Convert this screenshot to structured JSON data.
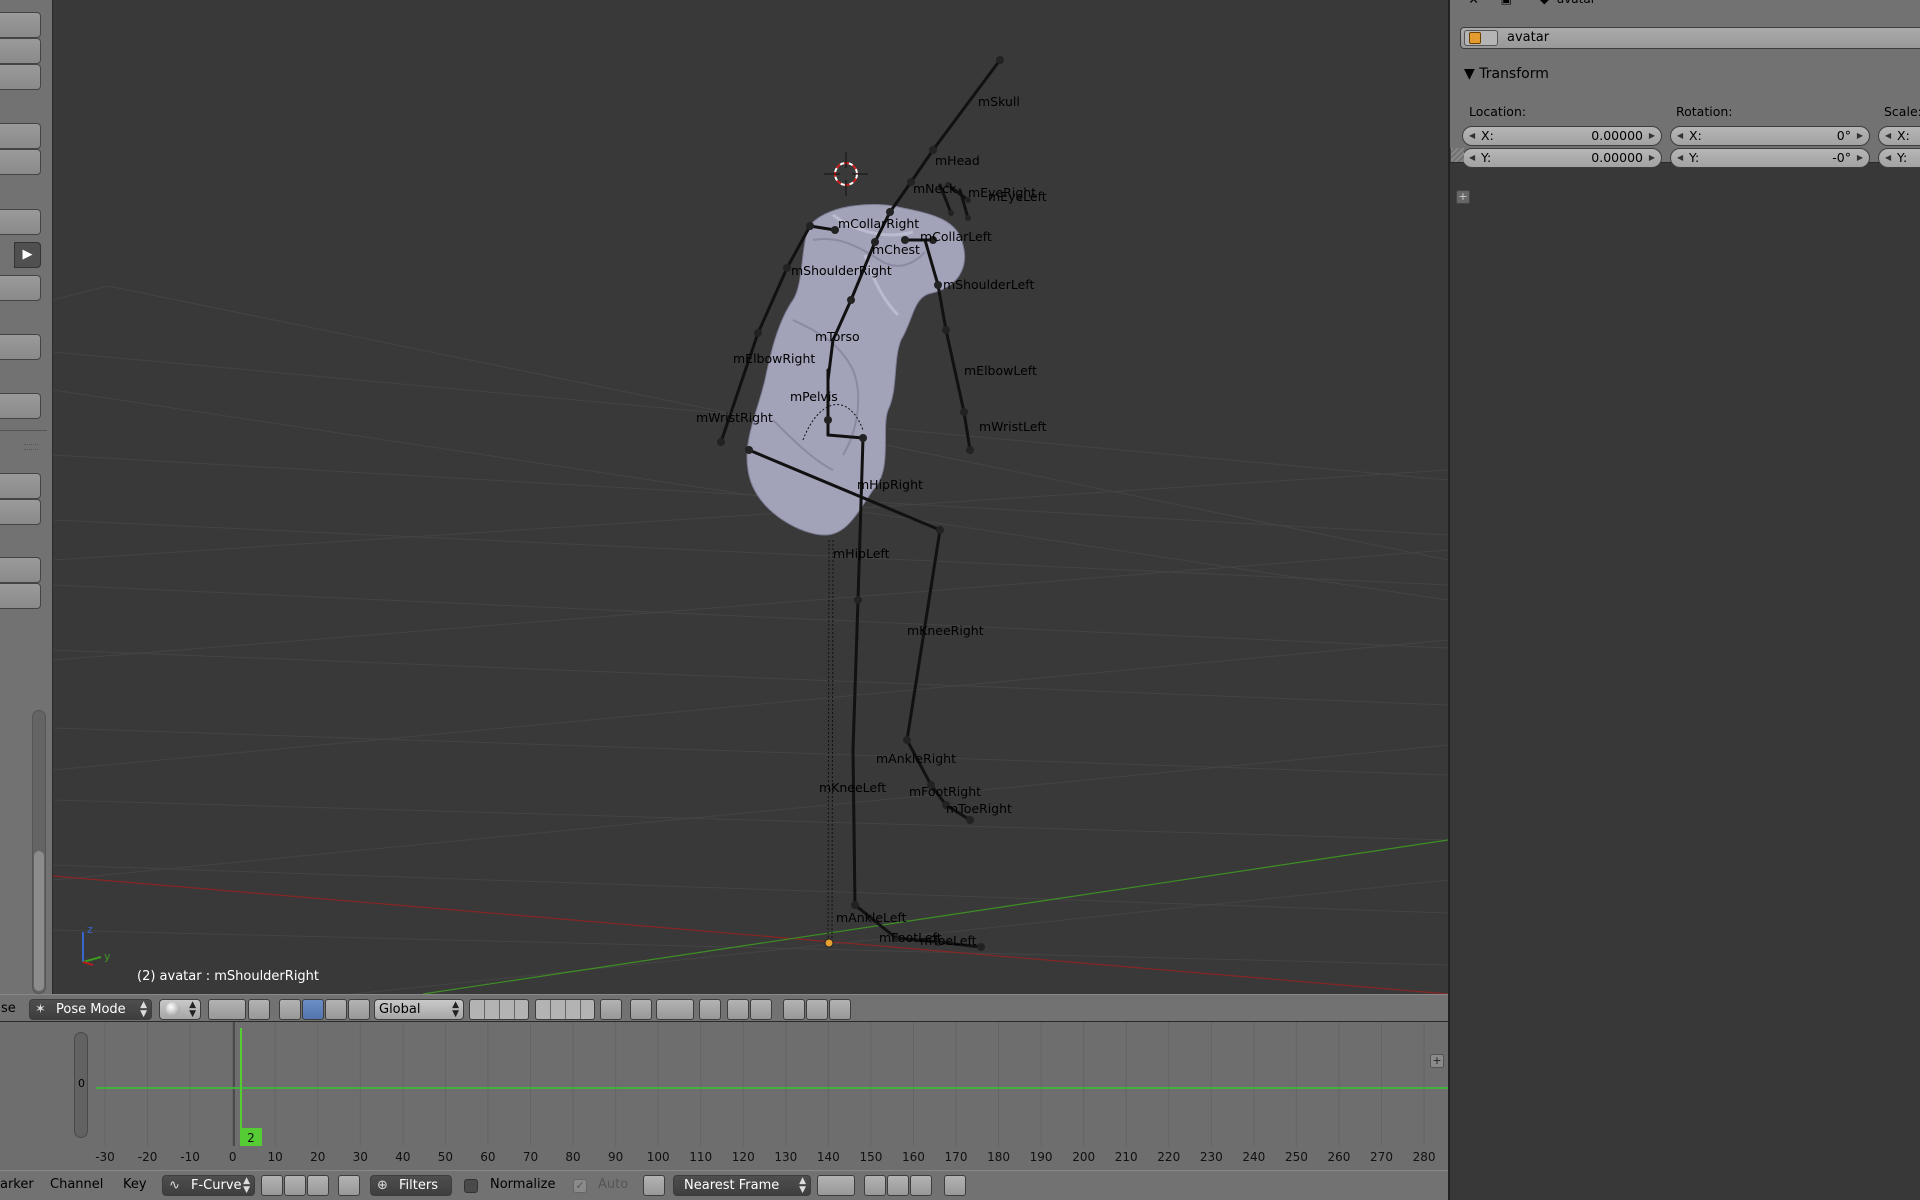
{
  "viewport": {
    "status": "(2) avatar : mShoulderRight",
    "axis_labels": {
      "z": "z",
      "y": "y"
    },
    "bones": [
      {
        "label": "mSkull"
      },
      {
        "label": "mHead"
      },
      {
        "label": "mNeck"
      },
      {
        "label": "mEyeRight"
      },
      {
        "label": "mEyeLeft"
      },
      {
        "label": "mCollarRight"
      },
      {
        "label": "mCollarLeft"
      },
      {
        "label": "mChest"
      },
      {
        "label": "mShoulderRight"
      },
      {
        "label": "mShoulderLeft"
      },
      {
        "label": "mTorso"
      },
      {
        "label": "mElbowRight"
      },
      {
        "label": "mElbowLeft"
      },
      {
        "label": "mPelvis"
      },
      {
        "label": "mWristRight"
      },
      {
        "label": "mWristLeft"
      },
      {
        "label": "mHipRight"
      },
      {
        "label": "mHipLeft"
      },
      {
        "label": "mKneeRight"
      },
      {
        "label": "mAnkleRight"
      },
      {
        "label": "mFootRight"
      },
      {
        "label": "mKneeLeft"
      },
      {
        "label": "mToeRight"
      },
      {
        "label": "mAnkleLeft"
      },
      {
        "label": "mFootLeft"
      },
      {
        "label": "mToeLeft"
      }
    ]
  },
  "header3d": {
    "menu_fragment": "se",
    "mode": "Pose Mode",
    "orientation": "Global"
  },
  "timeline": {
    "y_label": "0",
    "current_frame": "2",
    "ticks": [
      "-30",
      "-20",
      "-10",
      "0",
      "10",
      "20",
      "30",
      "40",
      "50",
      "60",
      "70",
      "80",
      "90",
      "100",
      "110",
      "120",
      "130",
      "140",
      "150",
      "160",
      "170",
      "180",
      "190",
      "200",
      "210",
      "220",
      "230",
      "240",
      "250",
      "260",
      "270",
      "280"
    ]
  },
  "header_graph": {
    "menu_marker": "arker",
    "menu_channel": "Channel",
    "menu_key": "Key",
    "editor_mode": "F-Curve",
    "filters": "Filters",
    "normalize": "Normalize",
    "auto": "Auto",
    "snap": "Nearest Frame"
  },
  "properties": {
    "tab_fragment": "avatar",
    "object_name": "avatar",
    "transform_header": "Transform",
    "location_label": "Location:",
    "rotation_label": "Rotation:",
    "scale_label": "Scale:",
    "loc_x_label": "X:",
    "loc_x_value": "0.00000",
    "loc_y_label": "Y:",
    "loc_y_value": "0.00000",
    "rot_x_label": "X:",
    "rot_x_value": "0°",
    "rot_y_label": "Y:",
    "rot_y_value": "-0°",
    "scale_x_label": "X:",
    "scale_y_label": "Y:"
  },
  "colors": {
    "viewport_bg": "#393939",
    "panel_bg": "#727272",
    "frame_indicator": "#55cc33",
    "x_axis": "#9a2020",
    "y_axis": "#3a9a20",
    "mesh": "#a8a8c0"
  }
}
